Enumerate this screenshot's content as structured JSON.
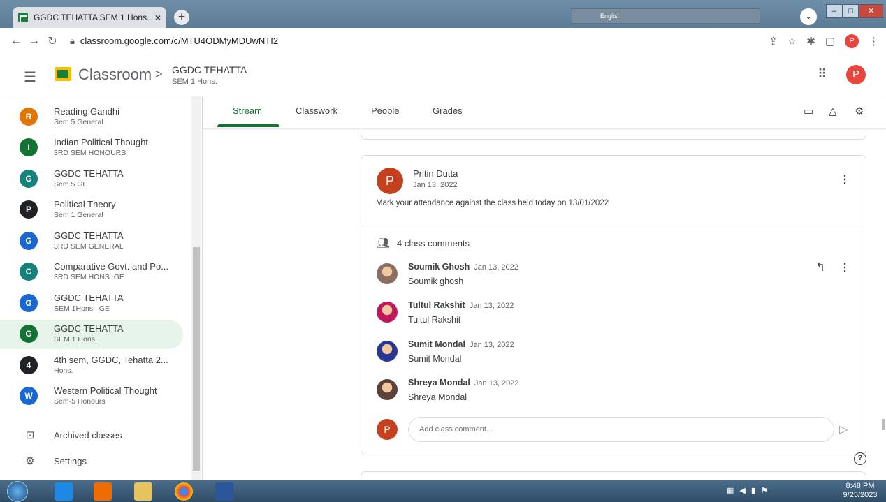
{
  "browser": {
    "tab_title": "GGDC TEHATTA SEM 1 Hons.",
    "tab_close": "×",
    "new_tab": "+",
    "url": "classroom.google.com/c/MTU4ODMyMDUwNTI2",
    "lang_label": "English",
    "profile_initial": "P"
  },
  "header": {
    "app_name": "Classroom",
    "separator": ">",
    "course_title": "GGDC TEHATTA",
    "course_section": "SEM 1 Hons.",
    "account_initial": "P"
  },
  "sidebar": {
    "classes": [
      {
        "initial": "R",
        "name": "Reading Gandhi",
        "section": "Sem 5 General",
        "color": "#e37400"
      },
      {
        "initial": "I",
        "name": "Indian Political Thought",
        "section": "3RD SEM HONOURS",
        "color": "#137333"
      },
      {
        "initial": "G",
        "name": "GGDC TEHATTA",
        "section": "Sem 5 GE",
        "color": "#12827a"
      },
      {
        "initial": "P",
        "name": "Political Theory",
        "section": "Sem 1 General",
        "color": "#202124"
      },
      {
        "initial": "G",
        "name": "GGDC TEHATTA",
        "section": "3RD SEM GENERAL",
        "color": "#1967d2"
      },
      {
        "initial": "C",
        "name": "Comparative Govt. and Po...",
        "section": "3RD SEM HONS. GE",
        "color": "#12827a"
      },
      {
        "initial": "G",
        "name": "GGDC TEHATTA",
        "section": "SEM 1Hons., GE",
        "color": "#1967d2"
      },
      {
        "initial": "G",
        "name": "GGDC TEHATTA",
        "section": "SEM 1 Hons.",
        "color": "#137333"
      },
      {
        "initial": "4",
        "name": "4th sem, GGDC, Tehatta 2...",
        "section": "Hons.",
        "color": "#202124"
      },
      {
        "initial": "W",
        "name": "Western Political Thought",
        "section": "Sem-5 Honours",
        "color": "#1967d2"
      }
    ],
    "archived_label": "Archived classes",
    "settings_label": "Settings"
  },
  "tabs": [
    "Stream",
    "Classwork",
    "People",
    "Grades"
  ],
  "post": {
    "author_initial": "P",
    "author": "Pritin Dutta",
    "date": "Jan 13, 2022",
    "text": "Mark your attendance against the class held today on 13/01/2022",
    "comments_label": "4 class comments",
    "comments": [
      {
        "name": "Soumik Ghosh",
        "date": "Jan 13, 2022",
        "text": "Soumik ghosh",
        "avatar_color": "#8d6e63"
      },
      {
        "name": "Tultul Rakshit",
        "date": "Jan 13, 2022",
        "text": "Tultul Rakshit",
        "avatar_color": "#c2185b"
      },
      {
        "name": "Sumit Mondal",
        "date": "Jan 13, 2022",
        "text": "Sumit Mondal",
        "avatar_color": "#283593"
      },
      {
        "name": "Shreya Mondal",
        "date": "Jan 13, 2022",
        "text": "Shreya Mondal",
        "avatar_color": "#5d4037"
      }
    ],
    "my_initial": "P",
    "comment_placeholder": "Add class comment..."
  },
  "taskbar": {
    "time": "8:48 PM",
    "date": "9/25/2023"
  }
}
